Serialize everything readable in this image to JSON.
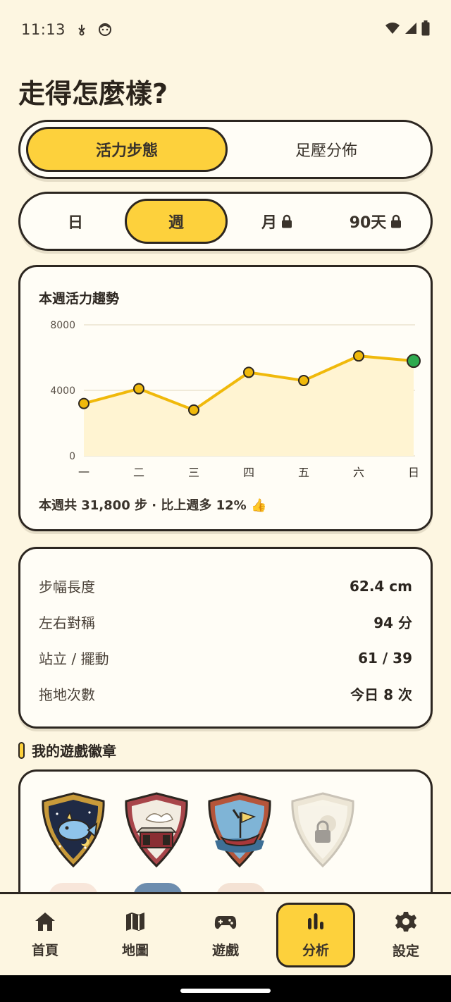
{
  "status_bar": {
    "time": "11:13"
  },
  "page_title": "走得怎麼樣?",
  "main_tabs": [
    {
      "label": "活力步態",
      "active": true
    },
    {
      "label": "足壓分佈",
      "active": false
    }
  ],
  "period_tabs": [
    {
      "label": "日",
      "active": false,
      "locked": false
    },
    {
      "label": "週",
      "active": true,
      "locked": false
    },
    {
      "label": "月",
      "active": false,
      "locked": true
    },
    {
      "label": "90天",
      "active": false,
      "locked": true
    }
  ],
  "chart_card": {
    "summary": "本週共 31,800 步 · 比上週多 12% 👍"
  },
  "chart_data": {
    "type": "area",
    "title": "本週活力趨勢",
    "categories": [
      "一",
      "二",
      "三",
      "四",
      "五",
      "六",
      "日"
    ],
    "values": [
      3200,
      4100,
      2800,
      5100,
      4600,
      6100,
      5800
    ],
    "ylim": [
      0,
      8000
    ],
    "yticks": [
      "8000",
      "4000",
      "0"
    ],
    "grid": true,
    "line_color": "#f0b90b",
    "fill_color": "#fff4d2",
    "highlight_color": "#2eaa4f"
  },
  "metrics": [
    {
      "label": "步幅長度",
      "value": "62.4 cm"
    },
    {
      "label": "左右對稱",
      "value": "94 分"
    },
    {
      "label": "站立 / 擺動",
      "value": "61 / 39"
    },
    {
      "label": "拖地次數",
      "value": "今日 8 次"
    }
  ],
  "badges_section": {
    "title": "我的遊戲徽章",
    "badges": [
      {
        "icon": "star-fish-badge-icon",
        "locked": false
      },
      {
        "icon": "tea-house-badge-icon",
        "locked": false
      },
      {
        "icon": "sailboat-badge-icon",
        "locked": false
      },
      {
        "icon": "locked-badge-icon",
        "locked": true
      }
    ]
  },
  "bottom_nav": [
    {
      "label": "首頁",
      "icon": "home-icon",
      "active": false
    },
    {
      "label": "地圖",
      "icon": "map-icon",
      "active": false
    },
    {
      "label": "遊戲",
      "icon": "gamepad-icon",
      "active": false
    },
    {
      "label": "分析",
      "icon": "bar-chart-icon",
      "active": true
    },
    {
      "label": "設定",
      "icon": "gear-icon",
      "active": false
    }
  ],
  "colors": {
    "accent": "#fdd13c",
    "background": "#fdf6e1",
    "ink": "#2c2620"
  }
}
